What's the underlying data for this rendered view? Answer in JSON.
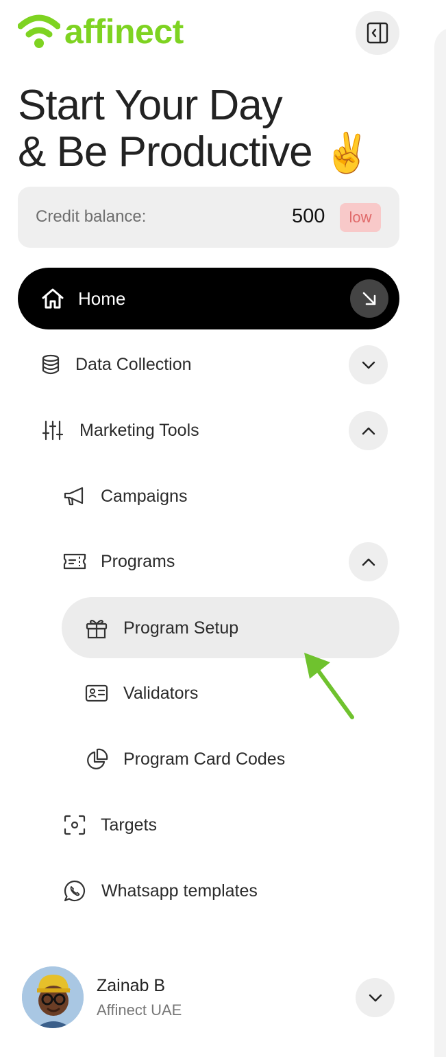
{
  "brand": {
    "name": "affinect",
    "color": "#7ed321"
  },
  "headline": {
    "line1": "Start Your Day",
    "line2": "& Be Productive",
    "emoji": "✌️"
  },
  "credit": {
    "label": "Credit balance:",
    "value": "500",
    "badge": "low"
  },
  "nav": {
    "home": "Home",
    "data_collection": "Data Collection",
    "marketing_tools": "Marketing Tools",
    "campaigns": "Campaigns",
    "programs": "Programs",
    "program_setup": "Program Setup",
    "validators": "Validators",
    "program_card_codes": "Program Card Codes",
    "targets": "Targets",
    "whatsapp_templates": "Whatsapp templates"
  },
  "user": {
    "name": "Zainab B",
    "org": "Affinect UAE"
  },
  "colors": {
    "active_bg": "#000000",
    "accent": "#7ed321",
    "badge_bg": "#f8c9c9",
    "badge_text": "#e06a6a"
  }
}
